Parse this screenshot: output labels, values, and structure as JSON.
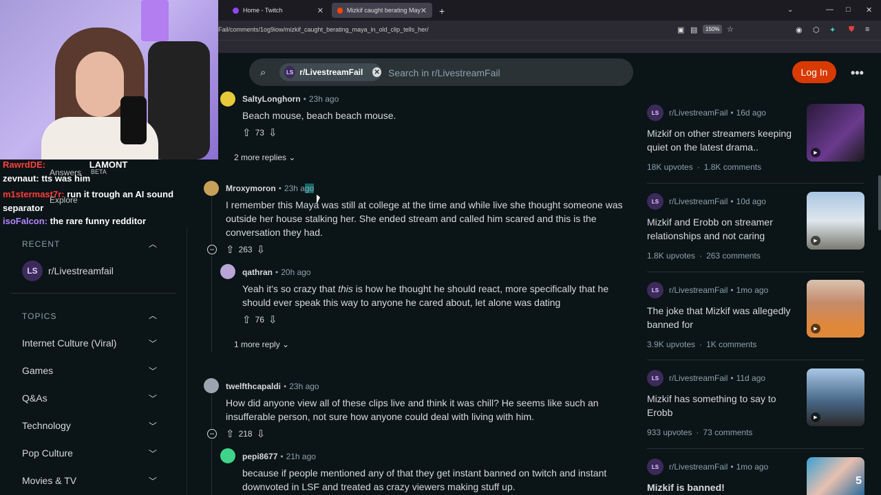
{
  "browser": {
    "tabs": [
      {
        "label": "Home - Twitch",
        "active": false
      },
      {
        "label": "Mizkif caught berating Maya in",
        "active": true
      }
    ],
    "new_tab": "+",
    "url": "Fail/comments/1og9iow/mizkif_caught_berating_maya_in_old_clip_tells_her/",
    "zoom": "150%",
    "window_controls": [
      "—",
      "□",
      "✕"
    ]
  },
  "stream": {
    "chat": [
      {
        "user": "RawrdDE:",
        "text": "LAMONT",
        "user_color": "#ff4040"
      },
      {
        "user": "zevnaut:",
        "text": "tts was him",
        "user_color": "#ffffff"
      },
      {
        "user": "m1stermast7r:",
        "text": "run it trough an AI sound separator",
        "user_color": "#ff3b3b"
      },
      {
        "user": "isoFalcon:",
        "text": "the rare funny redditor",
        "user_color": "#b388ff"
      }
    ],
    "ghost_labels": [
      "Answers",
      "BETA",
      "Explore"
    ]
  },
  "header": {
    "search_chip": "r/LivestreamFail",
    "chip_logo": "LS",
    "search_placeholder": "Search in r/LivestreamFail",
    "login": "Log In",
    "more": "•••"
  },
  "sidebar": {
    "recent_label": "RECENT",
    "recent_items": [
      {
        "label": "r/Livestreamfail",
        "logo": "LS"
      }
    ],
    "topics_label": "TOPICS",
    "topics": [
      "Internet Culture (Viral)",
      "Games",
      "Q&As",
      "Technology",
      "Pop Culture",
      "Movies & TV"
    ]
  },
  "comments": [
    {
      "user": "SaltyLonghorn",
      "time": "23h ago",
      "text": "Beach mouse, beach beach mouse.",
      "votes": "73",
      "avatar_color": "#e8c93a"
    },
    {
      "more_replies": "2 more replies"
    },
    {
      "user": "Mroxymoron",
      "time_main": "23h a",
      "time_hl": "go",
      "text": "I remember this Maya was still at college at the time and while live she thought someone was outside her house stalking her. She ended stream and called him scared and this is the conversation they had.",
      "votes": "263",
      "avatar_color": "#c7a15a"
    },
    {
      "user": "qathran",
      "time": "20h ago",
      "text_pre": "Yeah it's so crazy that ",
      "text_em": "this",
      "text_post": " is how he thought he should react, more specifically that he should ever speak this way to anyone he cared about, let alone was dating",
      "votes": "76",
      "avatar_color": "#b9a5d6"
    },
    {
      "more_replies": "1 more reply"
    },
    {
      "user": "twelfthcapaldi",
      "time": "23h ago",
      "text": "How did anyone view all of these clips live and think it was chill? He seems like such an insufferable person, not sure how anyone could deal with living with him.",
      "votes": "218",
      "avatar_color": "#9aa5b0"
    },
    {
      "user": "pepi8677",
      "time": "21h ago",
      "text": "because if people mentioned any of that they get instant banned on twitch and instant downvoted in LSF and treated as crazy viewers making stuff up.",
      "avatar_color": "#3fd48a"
    }
  ],
  "related": [
    {
      "sub": "r/LivestreamFail",
      "age": "16d ago",
      "title": "Mizkif on other streamers keeping quiet on the latest drama..",
      "upvotes": "18K upvotes",
      "comments": "1.8K comments",
      "thumb": "#4a2a5e"
    },
    {
      "sub": "r/LivestreamFail",
      "age": "10d ago",
      "title": "Mizkif and Erobb on streamer relationships and not caring",
      "upvotes": "1.8K upvotes",
      "comments": "263 comments",
      "thumb": "#8aa7c2"
    },
    {
      "sub": "r/LivestreamFail",
      "age": "1mo ago",
      "title": "The joke that Mizkif was allegedly banned for",
      "upvotes": "3.9K upvotes",
      "comments": "1K comments",
      "thumb": "#c58a6a"
    },
    {
      "sub": "r/LivestreamFail",
      "age": "11d ago",
      "title": "Mizkif has something to say to Erobb",
      "upvotes": "933 upvotes",
      "comments": "73 comments",
      "thumb": "#5a7aa0"
    },
    {
      "sub": "r/LivestreamFail",
      "age": "1mo ago",
      "title": "Mizkif is banned!",
      "thumb": "#2a8ab0",
      "badge": "5"
    }
  ]
}
